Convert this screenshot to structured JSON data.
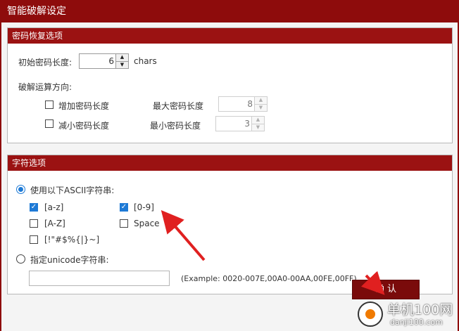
{
  "window": {
    "title": "智能破解设定"
  },
  "recovery": {
    "header": "密码恢复选项",
    "initial_length_label": "初始密码长度:",
    "initial_length_value": "6",
    "initial_length_unit": "chars",
    "direction_label": "破解运算方向:",
    "increase_label": "增加密码长度",
    "decrease_label": "减小密码长度",
    "max_label": "最大密码长度",
    "max_value": "8",
    "min_label": "最小密码长度",
    "min_value": "3"
  },
  "charset": {
    "header": "字符选项",
    "ascii_label": "使用以下ASCII字符串:",
    "options": [
      {
        "label": "[a-z]",
        "checked": true
      },
      {
        "label": "[0-9]",
        "checked": true
      },
      {
        "label": "[A-Z]",
        "checked": false
      },
      {
        "label": "Space",
        "checked": false
      },
      {
        "label": "[!\"#$%{|}~]",
        "checked": false
      }
    ],
    "unicode_label": "指定unicode字符串:",
    "unicode_value": "",
    "example": "(Example: 0020-007E,00A0-00AA,00FE,00FF)"
  },
  "confirm_label": "确 认",
  "watermark": {
    "main": "单机100网",
    "url": "danji100.com"
  },
  "colors": {
    "accent": "#8e0c0c",
    "check": "#1e7ad6",
    "arrow": "#e02020"
  }
}
